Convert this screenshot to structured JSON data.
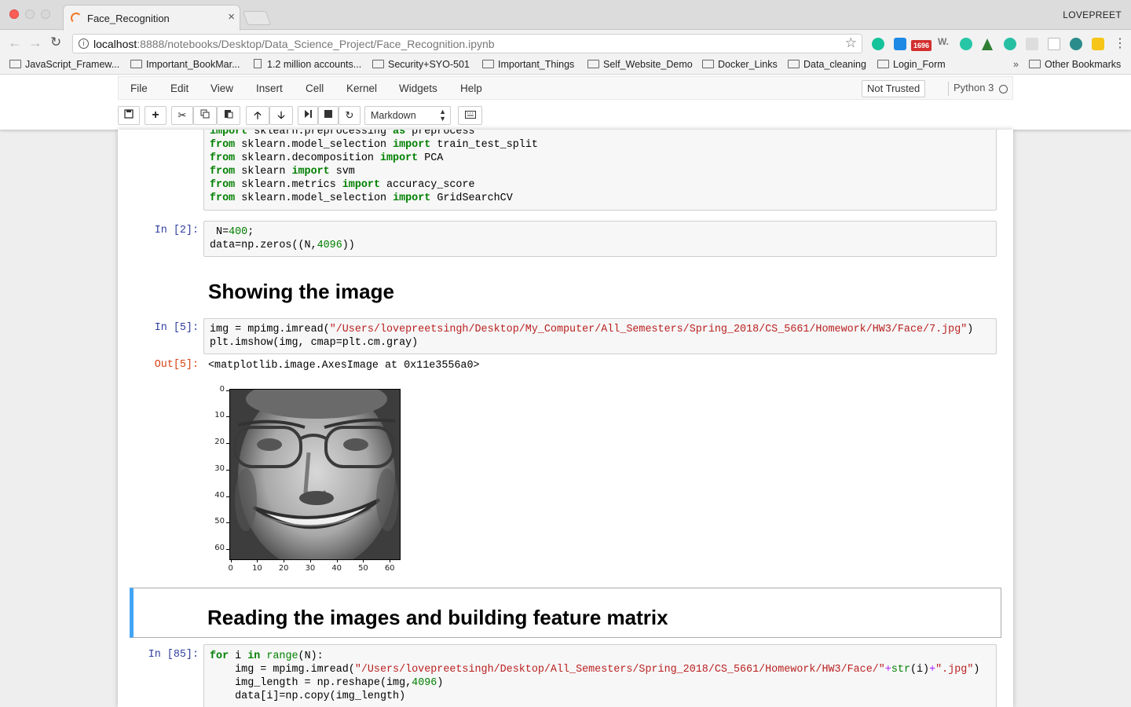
{
  "browser": {
    "tab_title": "Face_Recognition",
    "tab_close": "×",
    "user_name": "LOVEPREET",
    "url_host": "localhost",
    "url_rest": ":8888/notebooks/Desktop/Data_Science_Project/Face_Recognition.ipynb",
    "ext_badge": "1696",
    "ext_w": "W.",
    "bookmarks": [
      "JavaScript_Framew...",
      "Important_BookMar...",
      "1.2 million accounts...",
      "Security+SYO-501",
      "Important_Things",
      "Self_Website_Demo",
      "Docker_Links",
      "Data_cleaning",
      "Login_Form"
    ],
    "more_bookmarks": "»",
    "other_bookmarks": "Other Bookmarks"
  },
  "jupyter": {
    "menu": [
      "File",
      "Edit",
      "View",
      "Insert",
      "Cell",
      "Kernel",
      "Widgets",
      "Help"
    ],
    "trust_status": "Not Trusted",
    "kernel_name": "Python 3",
    "cell_type": "Markdown"
  },
  "cells": {
    "imports_tail": [
      [
        "kw:import",
        " sklearn.preprocessing ",
        "kw:as",
        " preprocess"
      ],
      [
        "kw:from",
        " sklearn.model_selection ",
        "kw:import",
        " train_test_split"
      ],
      [
        "kw:from",
        " sklearn.decomposition ",
        "kw:import",
        " PCA"
      ],
      [
        "kw:from",
        " sklearn ",
        "kw:import",
        " svm"
      ],
      [
        "kw:from",
        " sklearn.metrics ",
        "kw:import",
        " accuracy_score"
      ],
      [
        "kw:from",
        " sklearn.model_selection ",
        "kw:import",
        " GridSearchCV"
      ]
    ],
    "cell2_prompt": "In [2]:",
    "cell2_lines": [
      [
        " N=",
        "num:400",
        ";"
      ],
      [
        "data=np.zeros((N,",
        "num:4096",
        "))"
      ]
    ],
    "heading1": "Showing the image",
    "cell5_prompt": "In [5]:",
    "cell5_lines": [
      [
        "img = mpimg.imread(",
        "str:\"/Users/lovepreetsingh/Desktop/My_Computer/All_Semesters/Spring_2018/CS_5661/Homework/HW3/Face/7.jpg\"",
        ")"
      ],
      [
        "plt.imshow(img, cmap=plt.cm.gray)"
      ]
    ],
    "out5_prompt": "Out[5]:",
    "out5_text": "<matplotlib.image.AxesImage at 0x11e3556a0>",
    "plot_y_ticks": [
      "0",
      "10",
      "20",
      "30",
      "40",
      "50",
      "60"
    ],
    "plot_x_ticks": [
      "0",
      "10",
      "20",
      "30",
      "40",
      "50",
      "60"
    ],
    "heading2": "Reading the images and building feature matrix",
    "cell85_prompt": "In [85]:",
    "cell85_lines": [
      [
        "kw:for",
        " i ",
        "kw:in",
        " ",
        "bi:range",
        "(N):"
      ],
      [
        "    img = mpimg.imread(",
        "str:\"/Users/lovepreetsingh/Desktop/All_Semesters/Spring_2018/CS_5661/Homework/HW3/Face/\"",
        "pur:+",
        "bi:str",
        "(i)",
        "pur:+",
        "str:\".jpg\"",
        ")"
      ],
      [
        "    img_length = np.reshape(img,",
        "num:4096",
        ")"
      ],
      [
        "    data[i]=np.copy(img_length)"
      ]
    ]
  }
}
